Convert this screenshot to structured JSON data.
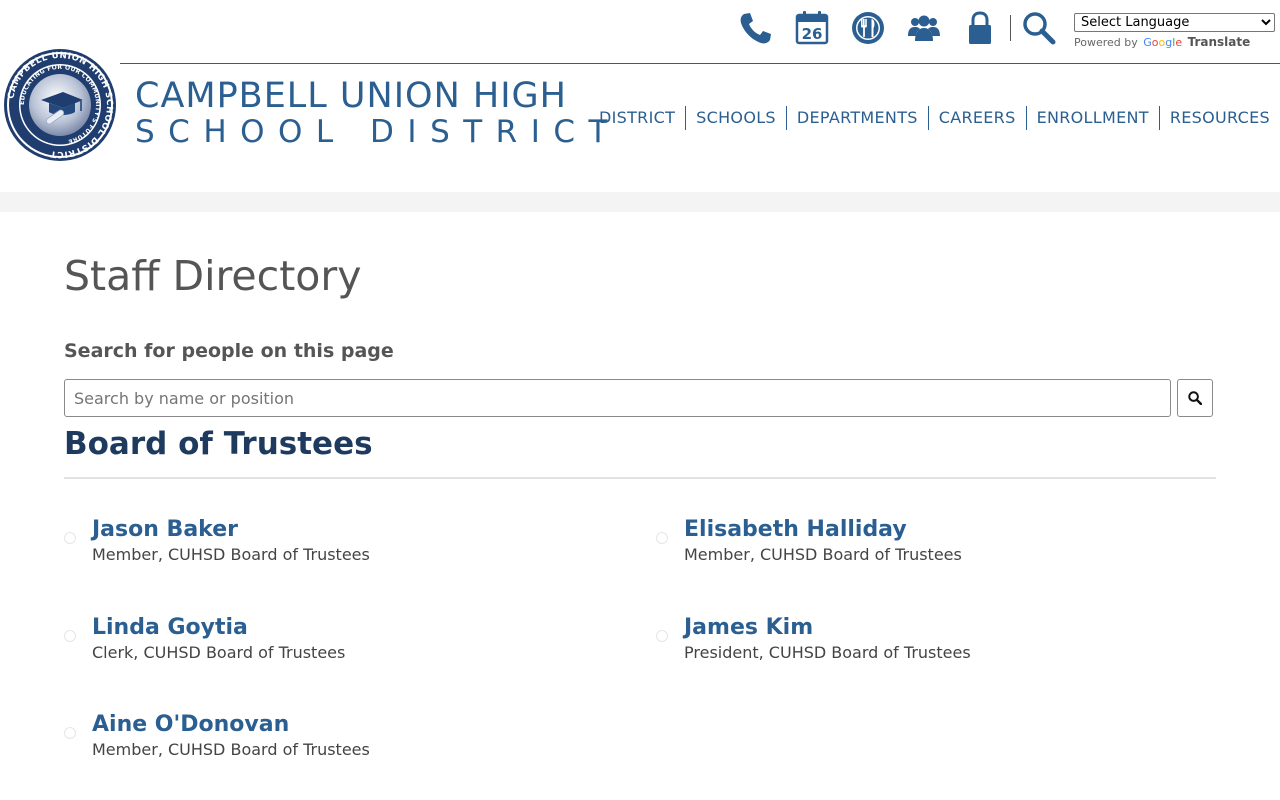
{
  "utility": {
    "icons": [
      "phone-icon",
      "calendar-icon",
      "dining-icon",
      "people-icon",
      "lock-icon",
      "search-icon"
    ],
    "calendar_day": "26"
  },
  "translate": {
    "select_label": "Select Language",
    "powered_by": "Powered by",
    "google": [
      "G",
      "o",
      "o",
      "g",
      "l",
      "e"
    ],
    "translate_word": "Translate"
  },
  "brand": {
    "line1": "CAMPBELL UNION HIGH",
    "line2": "SCHOOL DISTRICT",
    "seal_outer_text": "CAMPBELL UNION HIGH SCHOOL DISTRICT",
    "seal_inner_text": "EDUCATING FOR OUR COMMUNITY'S FUTURE"
  },
  "nav": {
    "items": [
      "DISTRICT",
      "SCHOOLS",
      "DEPARTMENTS",
      "CAREERS",
      "ENROLLMENT",
      "RESOURCES"
    ]
  },
  "page": {
    "title": "Staff Directory",
    "search_label": "Search for people on this page",
    "search_placeholder": "Search by name or position",
    "section_title": "Board of Trustees"
  },
  "people": [
    {
      "name": "Jason Baker",
      "title": "Member, CUHSD Board of Trustees"
    },
    {
      "name": "Elisabeth Halliday",
      "title": "Member, CUHSD Board of Trustees"
    },
    {
      "name": "Linda Goytia",
      "title": "Clerk, CUHSD Board of Trustees"
    },
    {
      "name": "James Kim",
      "title": "President, CUHSD Board of Trustees"
    },
    {
      "name": "Aine O'Donovan",
      "title": "Member, CUHSD Board of Trustees"
    }
  ],
  "colors": {
    "brand_blue": "#2b5f91",
    "dark_navy": "#1f3a5f",
    "text_gray": "#555555"
  }
}
